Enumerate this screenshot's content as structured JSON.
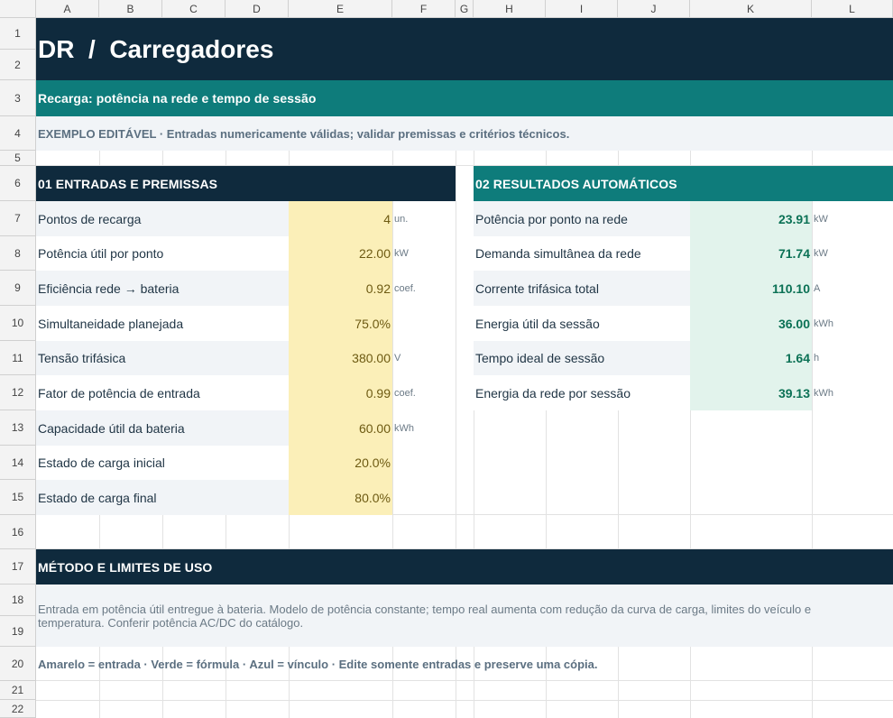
{
  "columns": [
    "A",
    "B",
    "C",
    "D",
    "E",
    "F",
    "G",
    "H",
    "I",
    "J",
    "K",
    "L"
  ],
  "rows": [
    "1",
    "2",
    "3",
    "4",
    "5",
    "6",
    "7",
    "8",
    "9",
    "10",
    "11",
    "12",
    "13",
    "14",
    "15",
    "16",
    "17",
    "18",
    "19",
    "20",
    "21",
    "22"
  ],
  "title": "DR  /  Carregadores",
  "subtitle": "Recarga: potência na rede e tempo de sessão",
  "note": "EXEMPLO EDITÁVEL · Entradas numericamente válidas; validar premissas e critérios técnicos.",
  "inputs": {
    "header": "01  ENTRADAS E PREMISSAS",
    "items": [
      {
        "label": "Pontos de recarga",
        "value": "4",
        "unit": "un."
      },
      {
        "label": "Potência útil por ponto",
        "value": "22.00",
        "unit": "kW"
      },
      {
        "label": "Eficiência rede → bateria",
        "value": "0.92",
        "unit": "coef."
      },
      {
        "label": "Simultaneidade planejada",
        "value": "75.0%",
        "unit": ""
      },
      {
        "label": "Tensão trifásica",
        "value": "380.00",
        "unit": "V"
      },
      {
        "label": "Fator de potência de entrada",
        "value": "0.99",
        "unit": "coef."
      },
      {
        "label": "Capacidade útil da bateria",
        "value": "60.00",
        "unit": "kWh"
      },
      {
        "label": "Estado de carga inicial",
        "value": "20.0%",
        "unit": ""
      },
      {
        "label": "Estado de carga final",
        "value": "80.0%",
        "unit": ""
      }
    ]
  },
  "results": {
    "header": "02  RESULTADOS AUTOMÁTICOS",
    "items": [
      {
        "label": "Potência por ponto na rede",
        "value": "23.91",
        "unit": "kW"
      },
      {
        "label": "Demanda simultânea da rede",
        "value": "71.74",
        "unit": "kW"
      },
      {
        "label": "Corrente trifásica total",
        "value": "110.10",
        "unit": "A"
      },
      {
        "label": "Energia útil da sessão",
        "value": "36.00",
        "unit": "kWh"
      },
      {
        "label": "Tempo ideal de sessão",
        "value": "1.64",
        "unit": "h"
      },
      {
        "label": "Energia da rede por sessão",
        "value": "39.13",
        "unit": "kWh"
      }
    ]
  },
  "method": {
    "header": "MÉTODO E LIMITES DE USO",
    "text": "Entrada em potência útil entregue à bateria. Modelo de potência constante; tempo real aumenta com redução da curva de carga, limites do veículo e temperatura. Conferir potência AC/DC do catálogo.",
    "legend": "Amarelo = entrada · Verde = fórmula · Azul = vínculo · Edite somente entradas e preserve uma cópia."
  },
  "colors": {
    "navy": "#0f2a3d",
    "teal": "#0e7c7b",
    "input_fill": "#fbefb8",
    "result_fill": "#e2f3ec"
  }
}
